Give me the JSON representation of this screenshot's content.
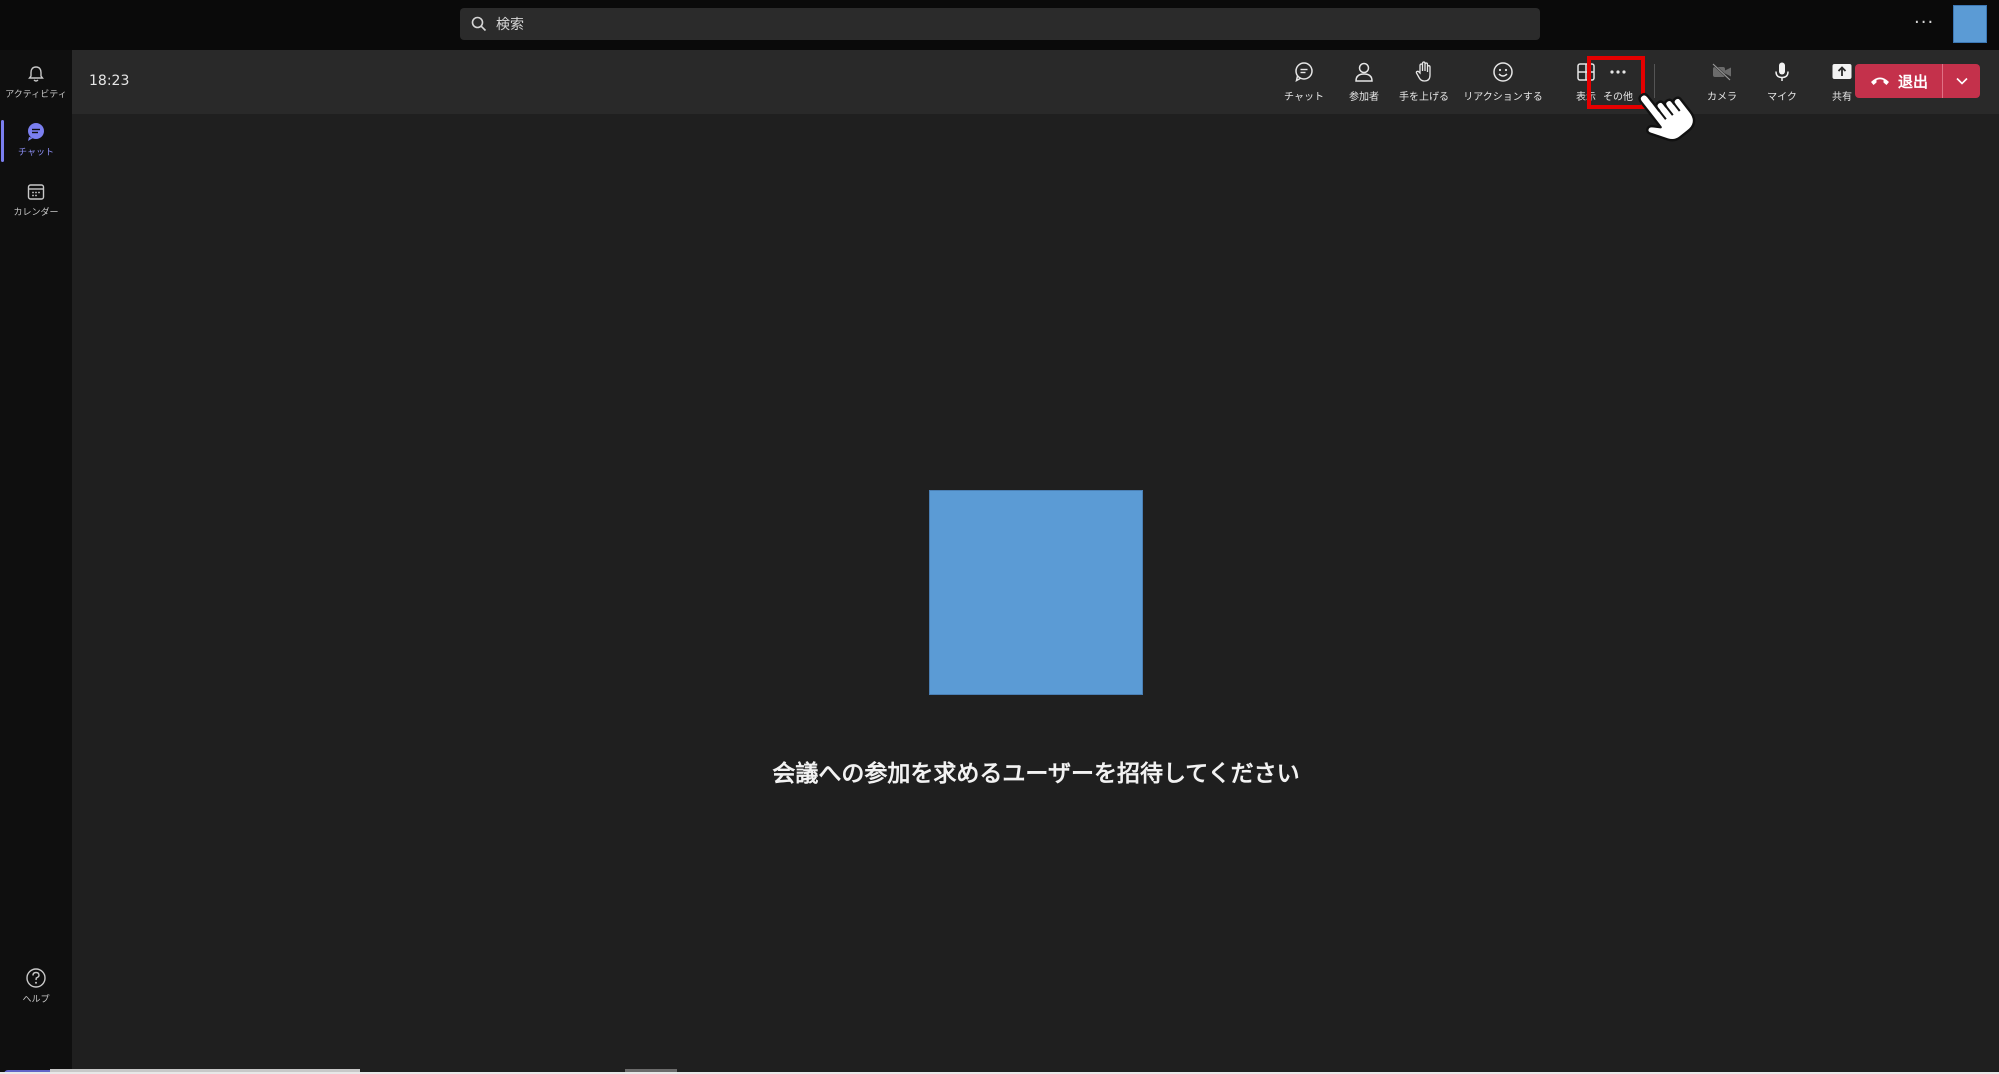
{
  "titlebar": {
    "search_placeholder": "検索",
    "more_label": "···"
  },
  "rail": {
    "items": [
      {
        "label": "アクティビティ",
        "icon": "bell-icon"
      },
      {
        "label": "チャット",
        "icon": "chat-icon",
        "active": true
      },
      {
        "label": "カレンダー",
        "icon": "calendar-icon"
      },
      {
        "label": "ヘルプ",
        "icon": "help-icon"
      }
    ],
    "download_icon": "download-icon"
  },
  "toolbar": {
    "time": "18:23",
    "buttons": [
      {
        "label": "チャット",
        "icon": "chat-icon"
      },
      {
        "label": "参加者",
        "icon": "people-icon"
      },
      {
        "label": "手を上げる",
        "icon": "raise-hand-icon"
      },
      {
        "label": "リアクションする",
        "icon": "emoji-icon"
      },
      {
        "label": "表示",
        "icon": "layout-icon"
      },
      {
        "label": "その他",
        "icon": "more-icon"
      },
      {
        "label": "カメラ",
        "icon": "camera-off-icon"
      },
      {
        "label": "マイク",
        "icon": "mic-icon"
      },
      {
        "label": "共有",
        "icon": "share-icon"
      }
    ],
    "leave_label": "退出"
  },
  "stage": {
    "invite_message": "会議への参加を求めるユーザーを招待してください"
  },
  "colors": {
    "accent": "#6264c8",
    "leave": "#c4314b",
    "highlight": "#e50000",
    "tile": "#5b9bd5"
  }
}
